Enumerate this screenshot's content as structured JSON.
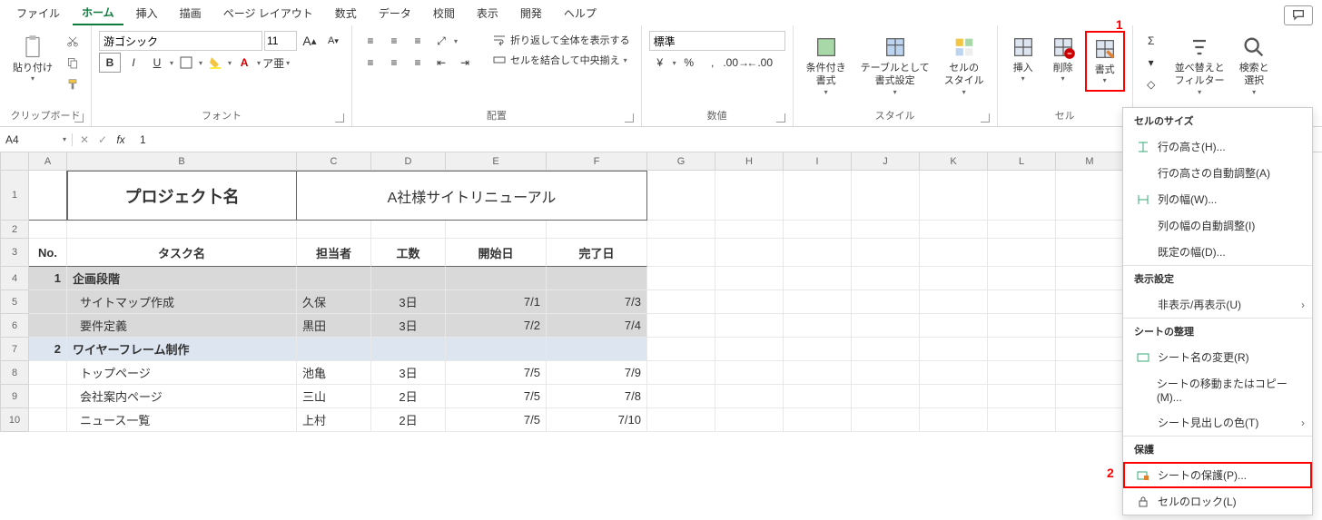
{
  "menu": {
    "file": "ファイル",
    "home": "ホーム",
    "insert": "挿入",
    "draw": "描画",
    "page_layout": "ページ レイアウト",
    "formulas": "数式",
    "data": "データ",
    "review": "校閲",
    "view": "表示",
    "developer": "開発",
    "help": "ヘルプ"
  },
  "ribbon": {
    "clipboard": {
      "paste": "貼り付け",
      "label": "クリップボード"
    },
    "font": {
      "name": "游ゴシック",
      "size": "11",
      "bold": "B",
      "italic": "I",
      "underline": "U",
      "label": "フォント"
    },
    "alignment": {
      "wrap": "折り返して全体を表示する",
      "merge": "セルを結合して中央揃え",
      "label": "配置"
    },
    "number": {
      "format": "標準",
      "label": "数値"
    },
    "styles": {
      "cond": "条件付き\n書式",
      "table_fmt": "テーブルとして\n書式設定",
      "cell_style": "セルの\nスタイル",
      "label": "スタイル"
    },
    "cells": {
      "insert": "挿入",
      "delete": "削除",
      "format": "書式",
      "label": "セル"
    },
    "editing": {
      "sort": "並べ替えと\nフィルター",
      "find": "検索と\n選択"
    }
  },
  "namebox": "A4",
  "formula_value": "1",
  "columns": [
    "A",
    "B",
    "C",
    "D",
    "E",
    "F",
    "G",
    "H",
    "I",
    "J",
    "K",
    "L",
    "M"
  ],
  "project": {
    "title_label": "プロジェク卜名",
    "title_value": "A社様サイトリニューアル"
  },
  "headers": {
    "no": "No.",
    "task": "タスク名",
    "owner": "担当者",
    "effort": "工数",
    "start": "開始日",
    "end": "完了日"
  },
  "rows": [
    {
      "no": "1",
      "task": "企画段階",
      "owner": "",
      "effort": "",
      "start": "",
      "end": "",
      "phase": true,
      "selected": true
    },
    {
      "no": "",
      "task": "サイトマップ作成",
      "owner": "久保",
      "effort": "3日",
      "start": "7/1",
      "end": "7/3",
      "selected": true
    },
    {
      "no": "",
      "task": "要件定義",
      "owner": "黒田",
      "effort": "3日",
      "start": "7/2",
      "end": "7/4",
      "selected": true
    },
    {
      "no": "2",
      "task": "ワイヤーフレーム制作",
      "owner": "",
      "effort": "",
      "start": "",
      "end": "",
      "phase": true,
      "blue": true
    },
    {
      "no": "",
      "task": "トップページ",
      "owner": "池亀",
      "effort": "3日",
      "start": "7/5",
      "end": "7/9"
    },
    {
      "no": "",
      "task": "会社案内ページ",
      "owner": "三山",
      "effort": "2日",
      "start": "7/5",
      "end": "7/8"
    },
    {
      "no": "",
      "task": "ニュース一覧",
      "owner": "上村",
      "effort": "2日",
      "start": "7/5",
      "end": "7/10"
    }
  ],
  "format_menu": {
    "cell_size": "セルのサイズ",
    "row_height": "行の高さ(H)...",
    "auto_row": "行の高さの自動調整(A)",
    "col_width": "列の幅(W)...",
    "auto_col": "列の幅の自動調整(I)",
    "default_w": "既定の幅(D)...",
    "visibility": "表示設定",
    "hide": "非表示/再表示(U)",
    "organize": "シートの整理",
    "rename": "シート名の変更(R)",
    "move": "シートの移動またはコピー(M)...",
    "tab_color": "シート見出しの色(T)",
    "protection": "保護",
    "protect_sheet": "シートの保護(P)...",
    "lock_cell": "セルのロック(L)"
  },
  "annot": {
    "n1": "1",
    "n2": "2"
  }
}
